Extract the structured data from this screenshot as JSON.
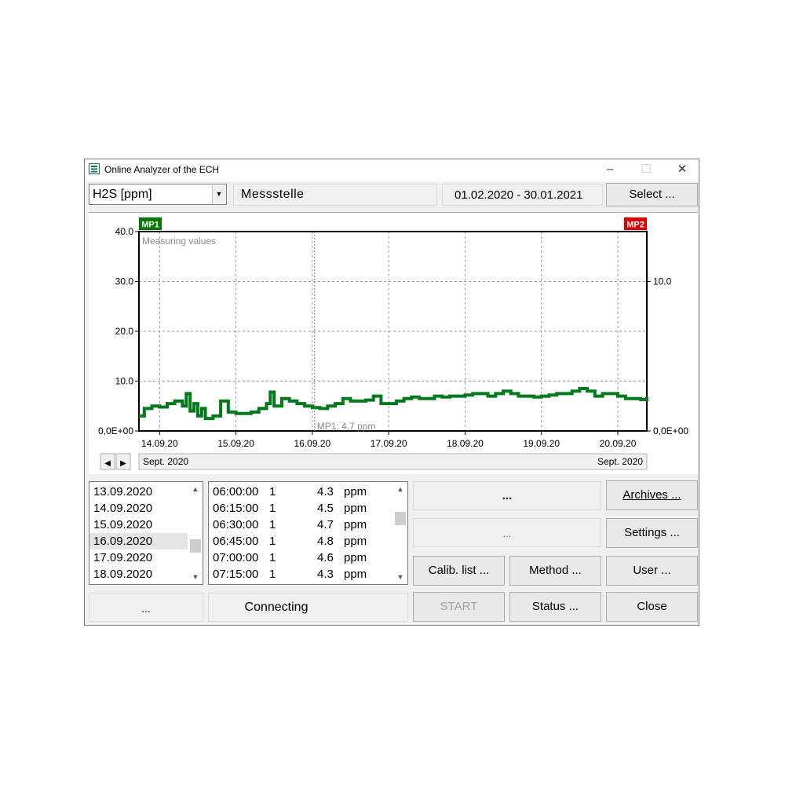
{
  "window": {
    "title": "Online Analyzer of the ECH",
    "minimize_glyph": "–",
    "maximize_glyph": "☐",
    "close_glyph": "✕"
  },
  "toolbar": {
    "parameter_selected": "H2S [ppm]",
    "location": "Messstelle",
    "date_range": "01.02.2020 - 30.01.2021",
    "select_button": "Select ..."
  },
  "chart_data": {
    "type": "line",
    "title": "Measuring values",
    "badge_left": "MP1",
    "badge_right": "MP2",
    "badge_left_color": "#007a00",
    "badge_right_color": "#e00000",
    "series_color": "#007a1a",
    "left_axis": {
      "ylim": [
        0,
        40
      ],
      "ticks": [
        "0,0E+00",
        "10.0",
        "20.0",
        "30.0",
        "40.0"
      ],
      "tick_values": [
        0,
        10,
        20,
        30,
        40
      ]
    },
    "right_axis": {
      "ylim": [
        0,
        13.33
      ],
      "ticks": [
        "0,0E+00",
        "10.0"
      ],
      "tick_values": [
        0,
        10
      ]
    },
    "x_range_days": [
      13.73,
      20.38
    ],
    "x_ticks": [
      "14.09.20",
      "15.09.20",
      "16.09.20",
      "17.09.20",
      "18.09.20",
      "19.09.20",
      "20.09.20"
    ],
    "x_tick_days": [
      14,
      15,
      16,
      17,
      18,
      19,
      20
    ],
    "cursor_day": 16.03,
    "cursor_label": "MP1: 4.7 ppm",
    "month_left": "Sept. 2020",
    "month_right": "Sept. 2020",
    "series": [
      {
        "x": [
          13.73,
          13.8,
          13.9,
          14.0,
          14.1,
          14.2,
          14.3,
          14.35,
          14.4,
          14.45,
          14.5,
          14.55,
          14.6,
          14.7,
          14.8,
          14.9,
          15.0,
          15.1,
          15.2,
          15.3,
          15.4,
          15.45,
          15.5,
          15.6,
          15.7,
          15.8,
          15.9,
          16.0,
          16.1,
          16.2,
          16.3,
          16.4,
          16.5,
          16.6,
          16.7,
          16.8,
          16.9,
          17.0,
          17.1,
          17.2,
          17.3,
          17.4,
          17.5,
          17.6,
          17.7,
          17.8,
          17.9,
          18.0,
          18.1,
          18.2,
          18.3,
          18.4,
          18.5,
          18.6,
          18.7,
          18.8,
          18.9,
          19.0,
          19.1,
          19.2,
          19.3,
          19.4,
          19.5,
          19.6,
          19.7,
          19.8,
          19.9,
          20.0,
          20.1,
          20.2,
          20.3,
          20.38
        ],
        "y": [
          3.0,
          4.5,
          5.0,
          4.8,
          5.5,
          6.0,
          5.0,
          7.5,
          4.0,
          5.5,
          3.0,
          4.5,
          2.5,
          3.0,
          6.0,
          3.8,
          3.5,
          3.5,
          3.8,
          4.5,
          5.5,
          7.8,
          5.0,
          6.5,
          6.0,
          5.5,
          5.0,
          4.7,
          4.5,
          5.0,
          5.5,
          6.5,
          6.0,
          6.0,
          6.2,
          7.0,
          5.5,
          5.5,
          6.0,
          6.5,
          6.8,
          6.5,
          6.5,
          7.0,
          6.8,
          7.0,
          7.0,
          7.2,
          7.5,
          7.5,
          7.0,
          7.5,
          8.0,
          7.5,
          7.0,
          7.0,
          6.8,
          7.0,
          7.2,
          7.5,
          7.5,
          8.0,
          8.5,
          8.0,
          7.0,
          7.5,
          7.5,
          7.0,
          6.5,
          6.5,
          6.3,
          6.8
        ]
      }
    ]
  },
  "dates_list": {
    "items": [
      "13.09.2020",
      "14.09.2020",
      "15.09.2020",
      "16.09.2020",
      "17.09.2020",
      "18.09.2020"
    ],
    "selected_index": 3
  },
  "values_list": {
    "rows": [
      {
        "time": "06:00:00",
        "mp": "1",
        "value": "4.3",
        "unit": "ppm"
      },
      {
        "time": "06:15:00",
        "mp": "1",
        "value": "4.5",
        "unit": "ppm"
      },
      {
        "time": "06:30:00",
        "mp": "1",
        "value": "4.7",
        "unit": "ppm"
      },
      {
        "time": "06:45:00",
        "mp": "1",
        "value": "4.8",
        "unit": "ppm"
      },
      {
        "time": "07:00:00",
        "mp": "1",
        "value": "4.6",
        "unit": "ppm"
      },
      {
        "time": "07:15:00",
        "mp": "1",
        "value": "4.3",
        "unit": "ppm"
      }
    ]
  },
  "status": {
    "left_field": "...",
    "connection": "Connecting",
    "info_top": "...",
    "info_bottom": "..."
  },
  "buttons": {
    "archives": "Archives ...",
    "settings": "Settings ...",
    "calib_list": "Calib. list ...",
    "method": "Method ...",
    "user": "User ...",
    "start": "START",
    "status": "Status ...",
    "close": "Close"
  },
  "scroll_glyphs": {
    "up": "▲",
    "down": "▼",
    "left": "◀",
    "right": "▶",
    "combo": "▼"
  }
}
